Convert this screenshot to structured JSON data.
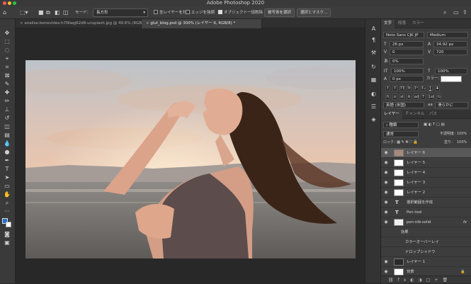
{
  "window": {
    "title": "Adobe Photoshop 2020"
  },
  "options_bar": {
    "mode_label": "モード：",
    "mode_value": "長方形",
    "all_layers_label": "全レイヤーを対象",
    "enhance_edge_label": "エッジを強調",
    "object_subtract_label": "オブジェクト一括削除",
    "select_subject_button": "被写体を選択",
    "select_mask_button": "選択とマスク..."
  },
  "document_tabs": [
    {
      "label": "analise-benevides-h7Nlaqj62d8-unsplash.jpg @ 49.6% (RGB/8)"
    },
    {
      "label": "glut_blog.psd @ 300% (レイヤー 6, RGB/8) *"
    }
  ],
  "character_panel": {
    "tabs": [
      "文字",
      "段落",
      "カラー"
    ],
    "font_family": "Noto Sans CJK JP",
    "font_style": "Medium",
    "font_size": "26 px",
    "leading": "34.92 px",
    "kerning": "0",
    "tracking": "720",
    "tsume": "0%",
    "vertical_scale": "100%",
    "horizontal_scale": "100%",
    "baseline_shift": "0 px",
    "color_label": "カラー：",
    "text_color": "#ffffff",
    "format_buttons": [
      "T",
      "T",
      "TT",
      "Tr",
      "T¹",
      "T₁",
      "T",
      "T"
    ],
    "ot_buttons": [
      "fi",
      "σ",
      "st",
      "A",
      "ad",
      "T",
      "1st",
      "½"
    ],
    "language": "英語 (米国)",
    "antialias": "aa",
    "antialias_mode": "滑らかに"
  },
  "layers_panel": {
    "tabs": [
      "レイヤー",
      "チャンネル",
      "パス"
    ],
    "filter_kind": "種類",
    "blend_mode": "通常",
    "opacity_label": "不透明度：",
    "opacity_value": "100%",
    "lock_label": "ロック：",
    "fill_label": "塗り：",
    "fill_value": "100%",
    "layers": [
      {
        "name": "レイヤー 6",
        "selected": true,
        "kind": "image"
      },
      {
        "name": "レイヤー 5",
        "kind": "image"
      },
      {
        "name": "レイヤー 4",
        "kind": "image"
      },
      {
        "name": "レイヤー 3",
        "kind": "image"
      },
      {
        "name": "レイヤー 2",
        "kind": "image"
      },
      {
        "name": "選択範囲を作成",
        "kind": "text"
      },
      {
        "name": "Pen tool",
        "kind": "text"
      },
      {
        "name": "pen-nib-solid",
        "kind": "shape",
        "fx": "fx"
      },
      {
        "name": "効果",
        "kind": "effect-header"
      },
      {
        "name": "カラーオーバーレイ",
        "kind": "effect"
      },
      {
        "name": "ドロップシャドウ",
        "kind": "effect"
      },
      {
        "name": "レイヤー 1",
        "kind": "dark"
      },
      {
        "name": "背景",
        "kind": "background"
      }
    ]
  },
  "colors": {
    "foreground": "#1f6fd1",
    "background": "#ffffff",
    "accent": "#2680eb"
  }
}
